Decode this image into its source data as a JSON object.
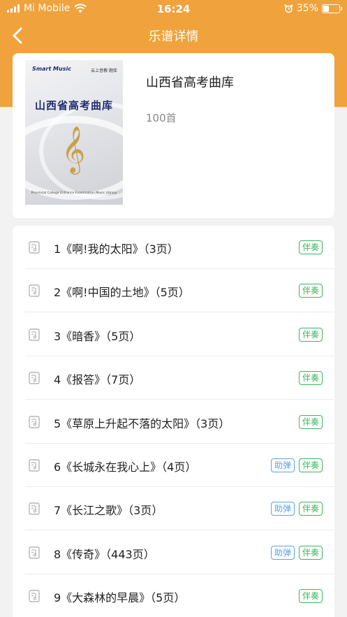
{
  "status_bar": {
    "carrier": "Mi Mobile",
    "time": "16:24",
    "battery": "35%",
    "battery_level": 0.35
  },
  "nav": {
    "title": "乐谱详情"
  },
  "book": {
    "title": "山西省高考曲库",
    "count": "100首",
    "cover": {
      "logo": "Smart Music",
      "tag": "云上音教·题库",
      "title": "山西省高考曲库",
      "subtitle": "Provincial College Entrance Examination Music Library"
    }
  },
  "tag_labels": {
    "accompany": "伴奏",
    "help": "助弹"
  },
  "songs": [
    {
      "label": "1《啊!我的太阳》（3页）",
      "help": false,
      "accompany": true
    },
    {
      "label": "2《啊!中国的土地》（5页）",
      "help": false,
      "accompany": true
    },
    {
      "label": "3《暗香》（5页）",
      "help": false,
      "accompany": true
    },
    {
      "label": "4《报答》（7页）",
      "help": false,
      "accompany": true
    },
    {
      "label": "5《草原上升起不落的太阳》（3页）",
      "help": false,
      "accompany": true
    },
    {
      "label": "6《长城永在我心上》（4页）",
      "help": true,
      "accompany": true
    },
    {
      "label": "7《长江之歌》（3页）",
      "help": true,
      "accompany": true
    },
    {
      "label": "8《传奇》（443页）",
      "help": true,
      "accompany": true
    },
    {
      "label": "9《大森林的早晨》（5页）",
      "help": false,
      "accompany": true
    }
  ],
  "colors": {
    "header": "#f0a23c",
    "accompany_tag": "#3db55e",
    "help_tag": "#5aa4e6"
  }
}
